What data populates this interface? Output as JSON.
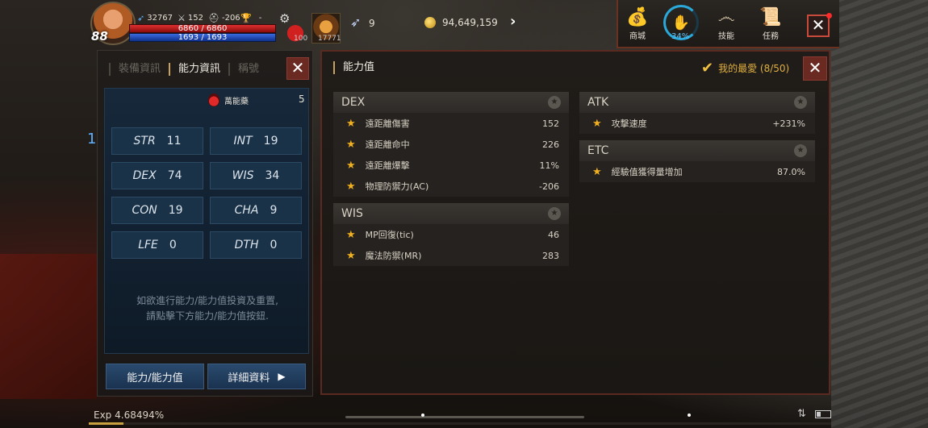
{
  "hud": {
    "level": "88",
    "stat1": "32767",
    "stat2": "152",
    "stat3": "-206",
    "stat4": "-",
    "hp": "6860 / 6860",
    "mp": "1693 / 1693",
    "potion_count": "100",
    "slot2_count": "17771",
    "feather_count": "9",
    "gold": "94,649,159"
  },
  "menu": {
    "shop": "商城",
    "progress_pct": "34%",
    "skill": "技能",
    "quest": "任務"
  },
  "left_panel": {
    "tabs": [
      "裝備資訊",
      "能力資訊",
      "稱號"
    ],
    "active_tab": 1,
    "potion_label": "萬能藥",
    "potion_value": "5",
    "stats": [
      {
        "key": "STR",
        "value": "11"
      },
      {
        "key": "INT",
        "value": "19"
      },
      {
        "key": "DEX",
        "value": "74"
      },
      {
        "key": "WIS",
        "value": "34"
      },
      {
        "key": "CON",
        "value": "19"
      },
      {
        "key": "CHA",
        "value": "9"
      },
      {
        "key": "LFE",
        "value": "0"
      },
      {
        "key": "DTH",
        "value": "0"
      }
    ],
    "hint_line1": "如欲進行能力/能力值投資及重置,",
    "hint_line2": "請點擊下方能力/能力值按鈕.",
    "btn_ability": "能力/能力值",
    "btn_detail": "詳細資料"
  },
  "right_panel": {
    "title": "能力值",
    "favorites": "我的最愛 (8/50)",
    "groups": {
      "dex": {
        "name": "DEX",
        "rows": [
          {
            "label": "遠距離傷害",
            "value": "152"
          },
          {
            "label": "遠距離命中",
            "value": "226"
          },
          {
            "label": "遠距離爆擊",
            "value": "11%"
          },
          {
            "label": "物理防禦力(AC)",
            "value": "-206"
          }
        ]
      },
      "wis": {
        "name": "WIS",
        "rows": [
          {
            "label": "MP回復(tic)",
            "value": "46"
          },
          {
            "label": "魔法防禦(MR)",
            "value": "283"
          }
        ]
      },
      "atk": {
        "name": "ATK",
        "rows": [
          {
            "label": "攻擊速度",
            "value": "+231%"
          }
        ]
      },
      "etc": {
        "name": "ETC",
        "rows": [
          {
            "label": "經驗值獲得量增加",
            "value": "87.0%"
          }
        ]
      }
    }
  },
  "footer": {
    "exp": "Exp 4.68494%",
    "exp_progress": 0.0468
  },
  "side_marker": "1",
  "colors": {
    "accent_gold": "#c8a060",
    "hp_red": "#e03030",
    "mp_blue": "#3a6ae0",
    "star": "#f0b020",
    "close_red": "#c84a3a"
  }
}
